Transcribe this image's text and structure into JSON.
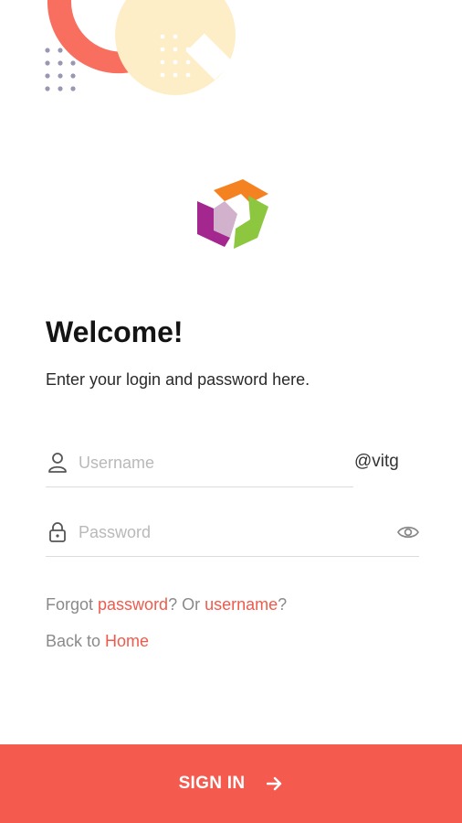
{
  "login": {
    "title": "Welcome!",
    "subtitle": "Enter your login and password here.",
    "username_placeholder": "Username",
    "username_value": "",
    "domain_suffix": "@vitg",
    "password_placeholder": "Password",
    "password_value": ""
  },
  "links": {
    "forgot_prefix": "Forgot ",
    "forgot_password": "password",
    "forgot_middle": "? Or ",
    "forgot_username": "username",
    "forgot_suffix": "?",
    "back_prefix": "Back to ",
    "back_home": "Home"
  },
  "actions": {
    "sign_in_label": "SIGN IN"
  },
  "icons": {
    "username": "user-icon",
    "password": "lock-icon",
    "show_password": "eye-icon",
    "sign_in": "arrow-right-icon",
    "logo": "app-logo"
  },
  "colors": {
    "accent": "#f45b4e",
    "link": "#f05a4c",
    "decor_coral": "#f96f5f",
    "decor_cream": "#fdeec8",
    "decor_dots": "#9898b4",
    "logo_orange": "#f58220",
    "logo_purple": "#a4268f",
    "logo_green": "#8dc63f"
  }
}
